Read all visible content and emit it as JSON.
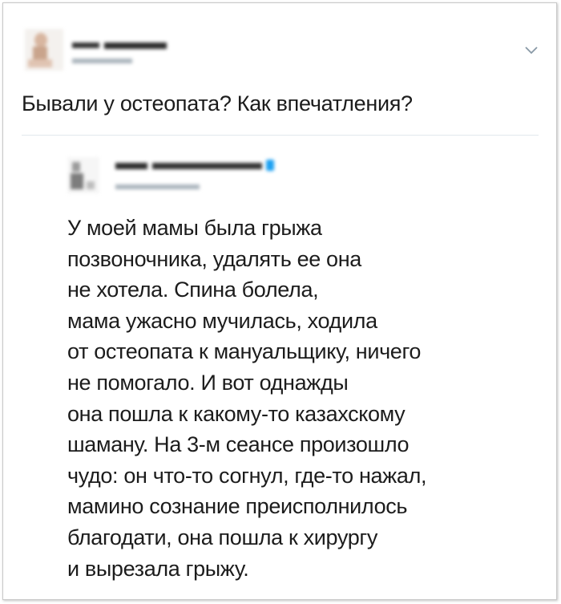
{
  "tweet": {
    "text": "Бывали у остеопата? Как впечатления?",
    "menu_icon": "chevron-down-icon"
  },
  "quoted_tweet": {
    "verified_icon": "verified-badge-icon",
    "lines": [
      "У моей мамы была грыжа",
      "позвоночника, удалять ее она",
      "не хотела. Спина болела,",
      "мама ужасно мучилась, ходила",
      "от остеопата к мануальщику, ничего",
      "не помогало. И вот однажды",
      "она пошла к какому-то казахскому",
      "шаману. На 3-м сеансе произошло",
      "чудо: он что-то согнул, где-то нажал,",
      "мамино сознание преисполнилось",
      "благодати, она пошла к хирургу",
      "и вырезала грыжу."
    ]
  },
  "colors": {
    "accent": "#1da1f2",
    "text": "#1c1c1c",
    "divider": "#e1e8ed"
  }
}
